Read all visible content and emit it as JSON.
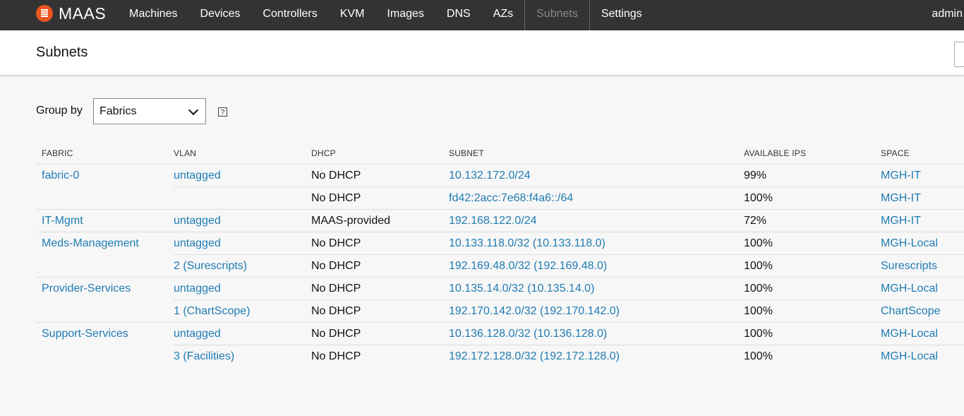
{
  "brand": {
    "name": "MAAS",
    "accent": "#e95420"
  },
  "nav": {
    "items": [
      {
        "label": "Machines",
        "active": false
      },
      {
        "label": "Devices",
        "active": false
      },
      {
        "label": "Controllers",
        "active": false
      },
      {
        "label": "KVM",
        "active": false
      },
      {
        "label": "Images",
        "active": false
      },
      {
        "label": "DNS",
        "active": false
      },
      {
        "label": "AZs",
        "active": false
      },
      {
        "label": "Subnets",
        "active": true
      },
      {
        "label": "Settings",
        "active": false
      }
    ],
    "user": "admin"
  },
  "header": {
    "title": "Subnets"
  },
  "groupby": {
    "label": "Group by",
    "selected": "Fabrics",
    "help_icon": "help-icon",
    "help_glyph": "?"
  },
  "table": {
    "columns": [
      "FABRIC",
      "VLAN",
      "DHCP",
      "SUBNET",
      "AVAILABLE IPS",
      "SPACE"
    ],
    "rows": [
      {
        "fabric": "fabric-0",
        "vlan": "untagged",
        "dhcp": "No DHCP",
        "subnet": "10.132.172.0/24",
        "available": "99%",
        "space": "MGH-IT"
      },
      {
        "fabric": "",
        "vlan": "",
        "dhcp": "No DHCP",
        "subnet": "fd42:2acc:7e68:f4a6::/64",
        "available": "100%",
        "space": "MGH-IT"
      },
      {
        "fabric": "IT-Mgmt",
        "vlan": "untagged",
        "dhcp": "MAAS-provided",
        "subnet": "192.168.122.0/24",
        "available": "72%",
        "space": "MGH-IT"
      },
      {
        "fabric": "Meds-Management",
        "vlan": "untagged",
        "dhcp": "No DHCP",
        "subnet": "10.133.118.0/32 (10.133.118.0)",
        "available": "100%",
        "space": "MGH-Local"
      },
      {
        "fabric": "",
        "vlan": "2 (Surescripts)",
        "dhcp": "No DHCP",
        "subnet": "192.169.48.0/32 (192.169.48.0)",
        "available": "100%",
        "space": "Surescripts"
      },
      {
        "fabric": "Provider-Services",
        "vlan": "untagged",
        "dhcp": "No DHCP",
        "subnet": "10.135.14.0/32 (10.135.14.0)",
        "available": "100%",
        "space": "MGH-Local"
      },
      {
        "fabric": "",
        "vlan": "1 (ChartScope)",
        "dhcp": "No DHCP",
        "subnet": "192.170.142.0/32 (192.170.142.0)",
        "available": "100%",
        "space": "ChartScope"
      },
      {
        "fabric": "Support-Services",
        "vlan": "untagged",
        "dhcp": "No DHCP",
        "subnet": "10.136.128.0/32 (10.136.128.0)",
        "available": "100%",
        "space": "MGH-Local"
      },
      {
        "fabric": "",
        "vlan": "3 (Facilities)",
        "dhcp": "No DHCP",
        "subnet": "192.172.128.0/32 (192.172.128.0)",
        "available": "100%",
        "space": "MGH-Local"
      }
    ]
  }
}
